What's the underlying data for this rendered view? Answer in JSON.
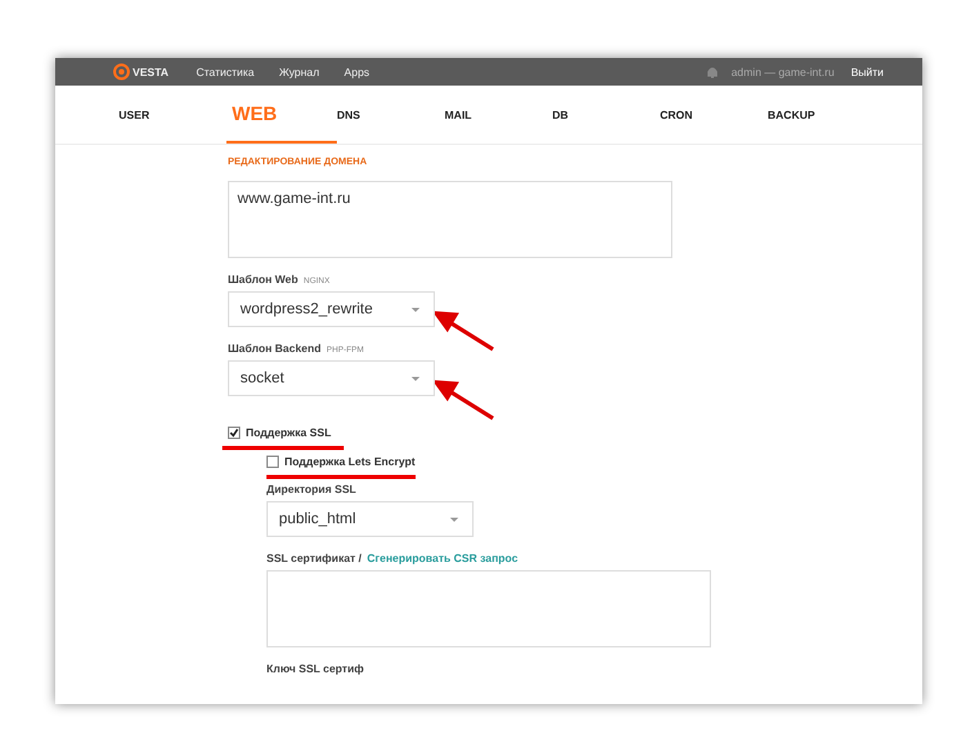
{
  "top_bar": {
    "logo": "VESTA",
    "menu": [
      "Статистика",
      "Журнал",
      "Apps"
    ],
    "user": "admin — game-int.ru",
    "logout": "Выйти"
  },
  "tabs": [
    {
      "label": "USER",
      "selected": false
    },
    {
      "label": "WEB",
      "selected": true
    },
    {
      "label": "DNS",
      "selected": false
    },
    {
      "label": "MAIL",
      "selected": false
    },
    {
      "label": "DB",
      "selected": false
    },
    {
      "label": "CRON",
      "selected": false
    },
    {
      "label": "BACKUP",
      "selected": false
    }
  ],
  "page_title": "РЕДАКТИРОВАНИЕ ДОМЕНА",
  "aliases": {
    "value": "www.game-int.ru"
  },
  "web_template": {
    "label": "Шаблон Web",
    "hint": "NGINX",
    "value": "wordpress2_rewrite"
  },
  "backend_template": {
    "label": "Шаблон Backend",
    "hint": "PHP-FPM",
    "value": "socket"
  },
  "ssl_support": {
    "label": "Поддержка SSL",
    "checked": true
  },
  "letsencrypt": {
    "label": "Поддержка Lets Encrypt",
    "checked": false
  },
  "ssl_dir": {
    "label": "Директория SSL",
    "value": "public_html"
  },
  "ssl_cert": {
    "label": "SSL сертификат /",
    "link": "Сгенерировать CSR запрос"
  },
  "ssl_key": {
    "label": "Ключ SSL сертиф"
  }
}
